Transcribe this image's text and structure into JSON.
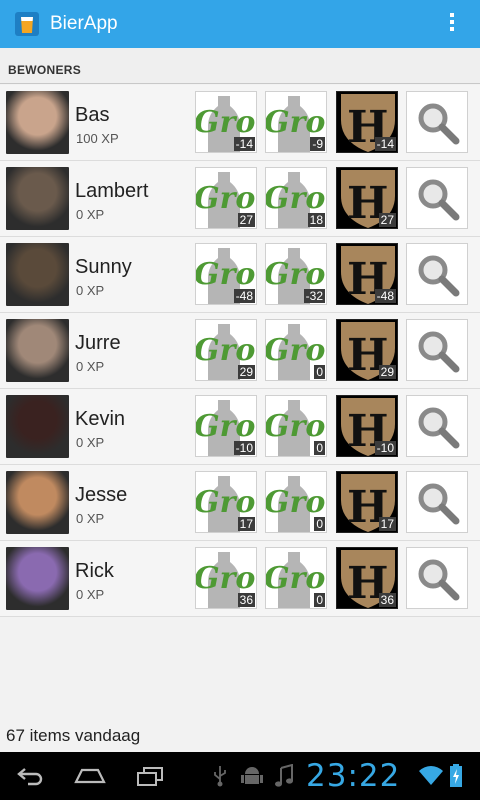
{
  "app": {
    "title": "BierApp",
    "accent": "#33a5e8"
  },
  "section": {
    "title": "BEWONERS"
  },
  "residents": [
    {
      "name": "Bas",
      "xp": "100 XP",
      "grolsch1": "-14",
      "grolsch2": "-9",
      "hertog": "-14",
      "avatar_color": "#c9a48c"
    },
    {
      "name": "Lambert",
      "xp": "0 XP",
      "grolsch1": "27",
      "grolsch2": "18",
      "hertog": "27",
      "avatar_color": "#6a5a4c"
    },
    {
      "name": "Sunny",
      "xp": "0 XP",
      "grolsch1": "-48",
      "grolsch2": "-32",
      "hertog": "-48",
      "avatar_color": "#5a4a3a"
    },
    {
      "name": "Jurre",
      "xp": "0 XP",
      "grolsch1": "29",
      "grolsch2": "0",
      "hertog": "29",
      "avatar_color": "#a08878"
    },
    {
      "name": "Kevin",
      "xp": "0 XP",
      "grolsch1": "-10",
      "grolsch2": "0",
      "hertog": "-10",
      "avatar_color": "#3a2220"
    },
    {
      "name": "Jesse",
      "xp": "0 XP",
      "grolsch1": "17",
      "grolsch2": "0",
      "hertog": "17",
      "avatar_color": "#c08a60"
    },
    {
      "name": "Rick",
      "xp": "0 XP",
      "grolsch1": "36",
      "grolsch2": "0",
      "hertog": "36",
      "avatar_color": "#8a6ab0"
    }
  ],
  "footer": {
    "text": "67 items vandaag"
  },
  "system": {
    "time": "23:22"
  },
  "icons": {
    "beer_logo": "grolsch-logo-icon",
    "hertog_logo": "hertog-jan-logo-icon",
    "search": "search-icon"
  }
}
